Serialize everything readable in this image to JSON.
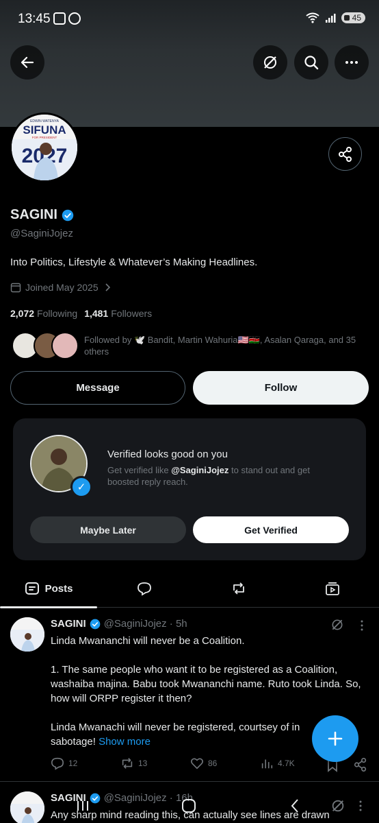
{
  "status_bar": {
    "time": "13:45",
    "battery": "45"
  },
  "profile": {
    "name": "SAGINI",
    "handle": "@SaginiJojez",
    "bio": "Into Politics, Lifestyle & Whatever’s Making Headlines.",
    "joined": "Joined May 2025",
    "following_count": "2,072",
    "following_label": "Following",
    "followers_count": "1,481",
    "followers_label": "Followers",
    "followed_by": "Followed by 🕊️ Bandit, Martin Wahuria🇺🇸🇰🇪, Asalan Qaraga, and 35 others",
    "avatar_text_top": "EDWIN WATENYA",
    "avatar_text_main": "SIFUNA",
    "avatar_text_sub": "FOR PRESIDENT",
    "avatar_year": "2027"
  },
  "buttons": {
    "message": "Message",
    "follow": "Follow"
  },
  "promo": {
    "title": "Verified looks good on you",
    "desc_prefix": "Get verified like ",
    "desc_handle": "@SaginiJojez",
    "desc_suffix": " to stand out and get boosted reply reach.",
    "maybe_later": "Maybe Later",
    "get_verified": "Get Verified"
  },
  "tabs": {
    "posts": "Posts"
  },
  "tweets": [
    {
      "name": "SAGINI",
      "meta": "@SaginiJojez · 5h",
      "body": "Linda Mwananchi will never be a Coalition.\n\n1. The same people who want it to be registered as a Coalition, washaiba majina. Babu took Mwananchi name. Ruto took Linda. So, how will ORPP register it then?\n\nLinda Mwanachi will never be registered, courtsey of in",
      "body_end": "sabotage! ",
      "show_more": "Show more",
      "replies": "12",
      "reposts": "13",
      "likes": "86",
      "views": "4.7K"
    },
    {
      "name": "SAGINI",
      "meta": "@SaginiJojez · 16h",
      "body": "Any sharp mind reading this,  can actually see lines are drawn"
    }
  ],
  "colors": {
    "accent": "#1d9bf0",
    "background": "#000000",
    "muted": "#71767b"
  }
}
